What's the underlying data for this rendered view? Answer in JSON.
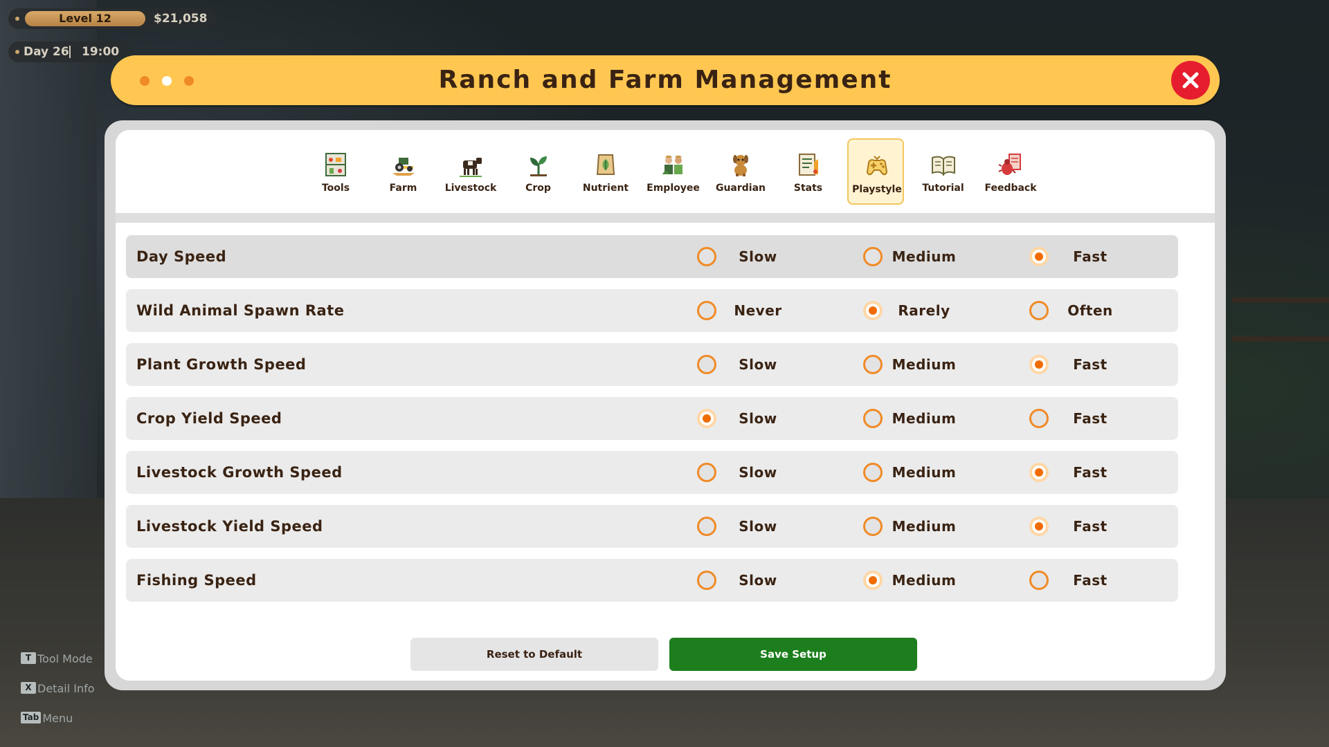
{
  "hud": {
    "level": "Level 12",
    "money": "$21,058",
    "day": "Day 26",
    "time": "19:00",
    "hints": [
      {
        "key": "T",
        "label": "Tool Mode"
      },
      {
        "key": "X",
        "label": "Detail Info"
      },
      {
        "key": "Tab",
        "label": "Menu"
      }
    ]
  },
  "window": {
    "title": "Ranch and Farm Management",
    "dot_colors": [
      "#f08a26",
      "#ffffff",
      "#f08a26"
    ]
  },
  "tabs": [
    {
      "label": "Tools",
      "icon": "tools-shelf-icon"
    },
    {
      "label": "Farm",
      "icon": "tractor-icon"
    },
    {
      "label": "Livestock",
      "icon": "cow-icon"
    },
    {
      "label": "Crop",
      "icon": "sprout-icon"
    },
    {
      "label": "Nutrient",
      "icon": "fertilizer-bag-icon"
    },
    {
      "label": "Employee",
      "icon": "farmers-icon"
    },
    {
      "label": "Guardian",
      "icon": "dog-icon"
    },
    {
      "label": "Stats",
      "icon": "stats-sheet-icon"
    },
    {
      "label": "Playstyle",
      "icon": "gamepad-icon",
      "active": true
    },
    {
      "label": "Tutorial",
      "icon": "book-icon"
    },
    {
      "label": "Feedback",
      "icon": "bug-report-icon"
    }
  ],
  "settings": [
    {
      "label": "Day Speed",
      "options": [
        "Slow",
        "Medium",
        "Fast"
      ],
      "selected": 2
    },
    {
      "label": "Wild Animal Spawn Rate",
      "options": [
        "Never",
        "Rarely",
        "Often"
      ],
      "selected": 1
    },
    {
      "label": "Plant Growth Speed",
      "options": [
        "Slow",
        "Medium",
        "Fast"
      ],
      "selected": 2
    },
    {
      "label": "Crop Yield Speed",
      "options": [
        "Slow",
        "Medium",
        "Fast"
      ],
      "selected": 0
    },
    {
      "label": "Livestock Growth Speed",
      "options": [
        "Slow",
        "Medium",
        "Fast"
      ],
      "selected": 2
    },
    {
      "label": "Livestock Yield Speed",
      "options": [
        "Slow",
        "Medium",
        "Fast"
      ],
      "selected": 2
    },
    {
      "label": "Fishing Speed",
      "options": [
        "Slow",
        "Medium",
        "Fast"
      ],
      "selected": 1
    }
  ],
  "buttons": {
    "reset": "Reset to Default",
    "save": "Save Setup"
  },
  "colors": {
    "accent": "#f08a26",
    "title_bar": "#ffc751",
    "close": "#e51d2e",
    "save": "#1d7e1d"
  }
}
